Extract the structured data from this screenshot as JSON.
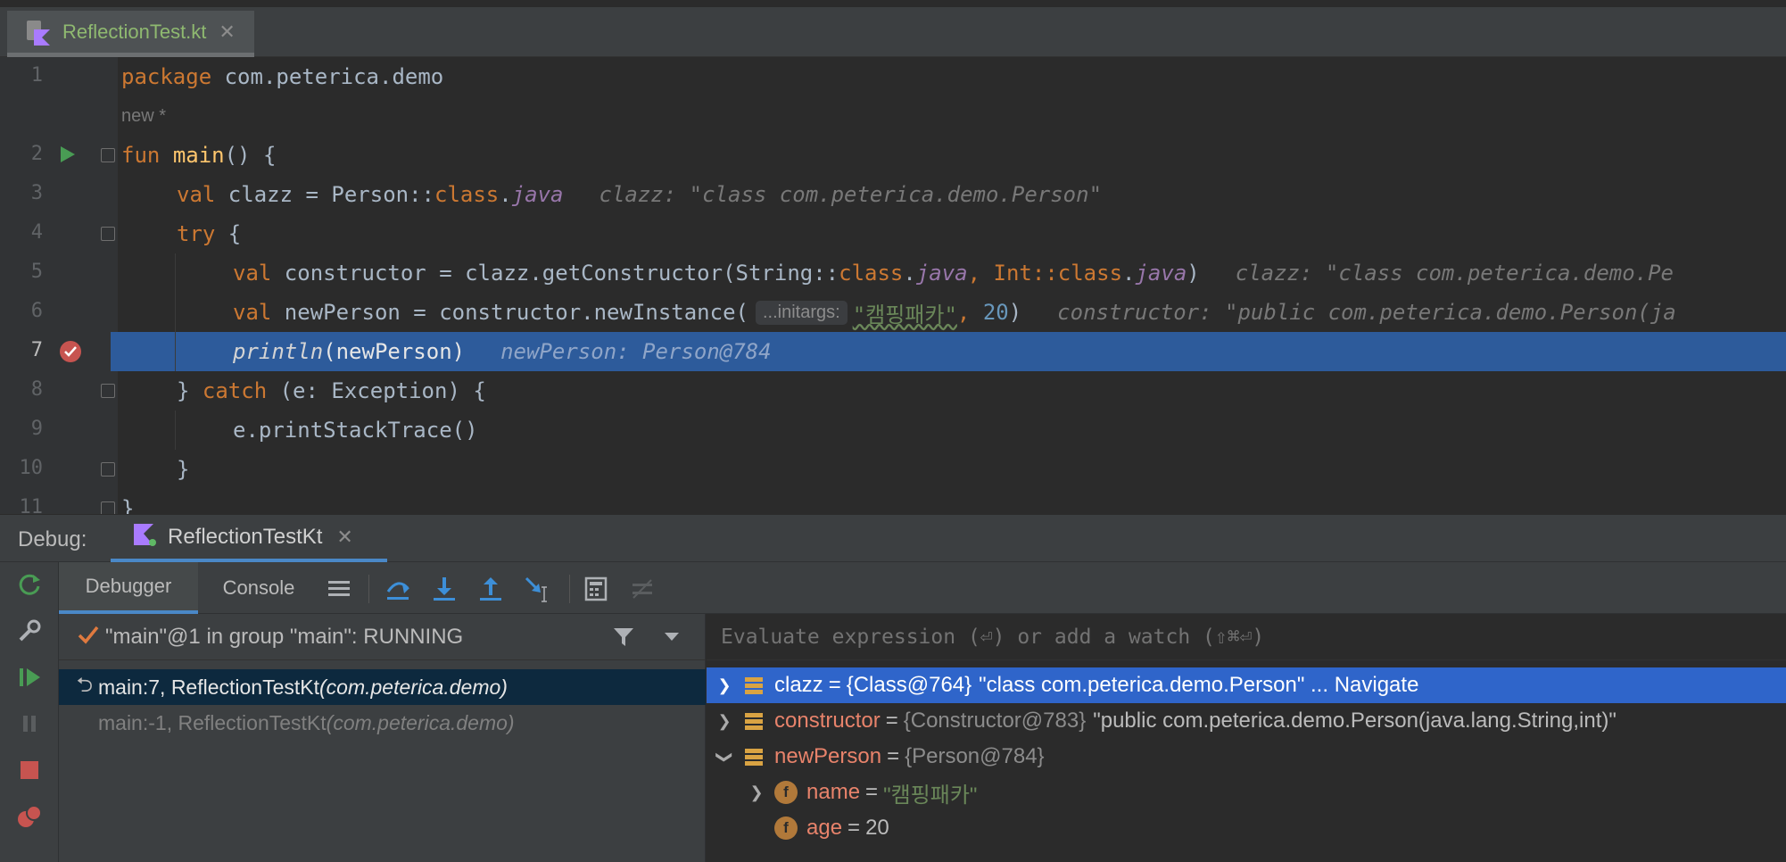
{
  "editor_tab": {
    "label": "ReflectionTest.kt",
    "close": "✕"
  },
  "code": {
    "new_hint": "new *",
    "line_numbers": [
      "1",
      "2",
      "3",
      "4",
      "5",
      "6",
      "7",
      "8",
      "9",
      "10",
      "11"
    ],
    "l1": {
      "kw": "package",
      "rest": " com.peterica.demo"
    },
    "l2": {
      "kw": "fun",
      "fn": "main",
      "rest": "() {"
    },
    "l3": {
      "kw": "val",
      "a": " clazz = Person::",
      "kw2": "class",
      "dot": ".",
      "java": "java",
      "hint": "clazz: \"class com.peterica.demo.Person\""
    },
    "l4": {
      "kw": "try",
      "rest": " {"
    },
    "l5": {
      "kw": "val",
      "a": " constructor = clazz.getConstructor(String::",
      "kw2": "class",
      "dot": ".",
      "java": "java",
      "comma": ", Int::",
      "kw3": "class",
      "dot2": ".",
      "java2": "java",
      "close": ")",
      "hint": "clazz: \"class com.peterica.demo.Pe"
    },
    "l6": {
      "kw": "val",
      "a": " newPerson = constructor.newInstance(",
      "param_hint": "...initargs:",
      "str": "\"캠핑패카\"",
      "comma": ", ",
      "num": "20",
      "close": ")",
      "hint": "constructor: \"public com.peterica.demo.Person(ja"
    },
    "l7": {
      "fn": "println",
      "rest": "(newPerson)",
      "hint": "newPerson: Person@784"
    },
    "l8": {
      "a": "} ",
      "kw": "catch",
      "rest": " (e: Exception) {"
    },
    "l9": {
      "rest": "e.printStackTrace()"
    },
    "l10": {
      "rest": "}"
    },
    "l11": {
      "rest": "}"
    }
  },
  "debug": {
    "title": "Debug:",
    "session_tab": "ReflectionTestKt",
    "session_close": "✕",
    "tabs": {
      "debugger": "Debugger",
      "console": "Console"
    },
    "thread": "\"main\"@1 in group \"main\": RUNNING",
    "frames": [
      {
        "method": "main:7, ReflectionTestKt ",
        "pkg": "(com.peterica.demo)"
      },
      {
        "method": "main:-1, ReflectionTestKt ",
        "pkg": "(com.peterica.demo)"
      }
    ],
    "watch_placeholder": "Evaluate expression (⏎) or add a watch (⇧⌘⏎)",
    "variables": [
      {
        "name": "clazz",
        "eq": "=",
        "type": "{Class@764}",
        "value": "\"class com.peterica.demo.Person\" ... Navigate"
      },
      {
        "name": "constructor",
        "eq": "=",
        "type": "{Constructor@783}",
        "value": "\"public com.peterica.demo.Person(java.lang.String,int)\""
      },
      {
        "name": "newPerson",
        "eq": "=",
        "type": "{Person@784}"
      },
      {
        "name": "name",
        "eq": "=",
        "value": "\"캠핑패카\"",
        "badge": "f"
      },
      {
        "name": "age",
        "eq": "=",
        "value": "20",
        "badge": "f"
      }
    ]
  },
  "colors": {
    "accent": "#4a88c7",
    "selection": "#2f65ca",
    "current_line": "#2d5b9b",
    "keyword": "#cc7832",
    "string": "#6a8759"
  }
}
